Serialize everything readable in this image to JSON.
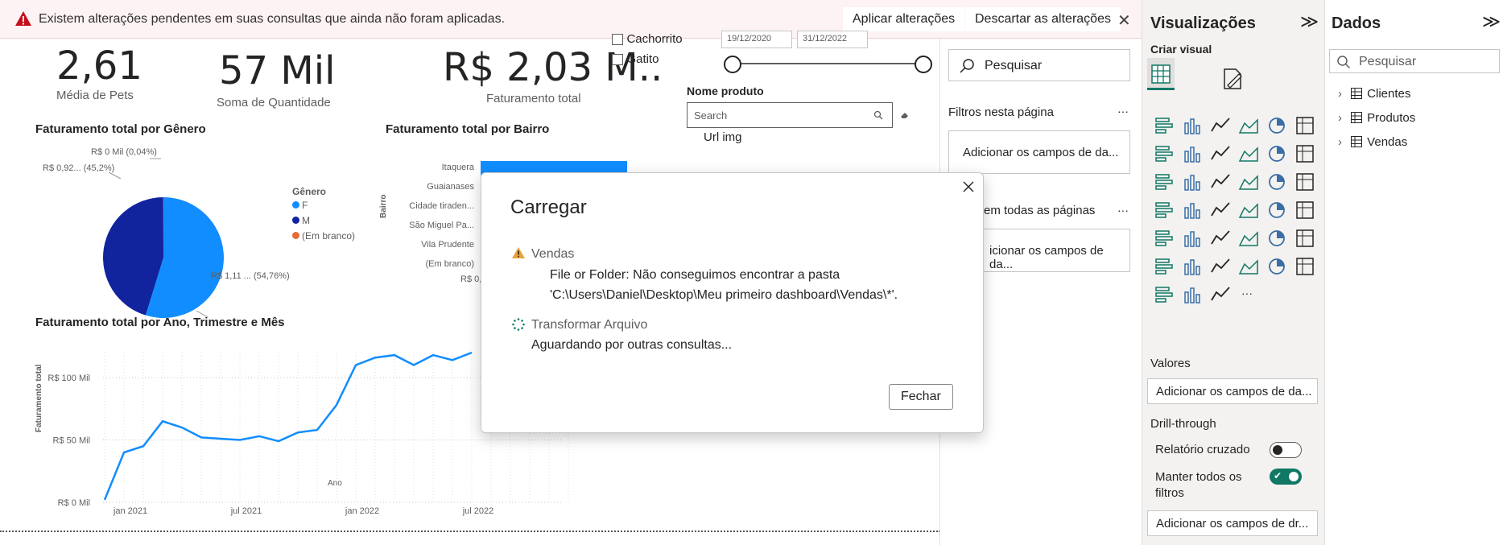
{
  "warning": {
    "message": "Existem alterações pendentes em suas consultas que ainda não foram aplicadas.",
    "apply_label": "Aplicar alterações",
    "discard_label": "Descartar as alterações",
    "close_glyph": "✕"
  },
  "cards": [
    {
      "value": "2,61",
      "label": "Média de Pets"
    },
    {
      "value": "57 Mil",
      "label": "Soma de Quantidade"
    },
    {
      "value": "R$ 2,03 M..",
      "label": "Faturamento total"
    }
  ],
  "slicer": {
    "options": [
      "Cachorrito",
      "Gatito"
    ],
    "date_start": "19/12/2020",
    "date_end": "31/12/2022",
    "product_title": "Nome produto",
    "search_placeholder": "Search",
    "url_label": "Url img"
  },
  "pie": {
    "title": "Faturamento total por Gênero",
    "legend_title": "Gênero",
    "legend": [
      {
        "name": "F",
        "color": "#118dff"
      },
      {
        "name": "M",
        "color": "#12239e"
      },
      {
        "name": "(Em branco)",
        "color": "#e66c37"
      }
    ],
    "labels": [
      "R$ 0 Mil (0,04%)",
      "R$ 0,92... (45,2%)",
      "R$ 1,11 ... (54,76%)"
    ]
  },
  "bar": {
    "title": "Faturamento total por Bairro",
    "ylabel": "Bairro",
    "categories": [
      "Itaquera",
      "Guaianases",
      "Cidade tiraden...",
      "São Miguel Pa...",
      "Vila Prudente",
      "(Em branco)"
    ],
    "first_tick": "R$ 0,"
  },
  "line": {
    "title": "Faturamento total por Ano, Trimestre e Mês",
    "ylabel": "Faturamento total",
    "xlabel": "Ano",
    "yticks": [
      "R$ 100 Mil",
      "R$ 50 Mil",
      "R$ 0 Mil"
    ],
    "xticks": [
      "jan 2021",
      "jul 2021",
      "jan 2022",
      "jul 2022"
    ]
  },
  "chart_data": [
    {
      "type": "pie",
      "title": "Faturamento total por Gênero",
      "categories": [
        "F",
        "M",
        "(Em branco)"
      ],
      "values": [
        54.76,
        45.2,
        0.04
      ],
      "legend_title": "Gênero",
      "legend_position": "right",
      "colors": [
        "#118dff",
        "#12239e",
        "#e66c37"
      ]
    },
    {
      "type": "bar",
      "title": "Faturamento total por Bairro",
      "ylabel": "Bairro",
      "categories": [
        "Itaquera",
        "Guaianases",
        "Cidade tiraden...",
        "São Miguel Pa...",
        "Vila Prudente",
        "(Em branco)"
      ],
      "values": [
        1.0,
        0.95,
        0.4,
        0.25,
        0.15,
        0.05
      ]
    },
    {
      "type": "line",
      "title": "Faturamento total por Ano, Trimestre e Mês",
      "xlabel": "Ano",
      "ylabel": "Faturamento total",
      "x": [
        "dez 2020",
        "jan 2021",
        "fev 2021",
        "mar 2021",
        "abr 2021",
        "mai 2021",
        "jun 2021",
        "jul 2021",
        "ago 2021",
        "set 2021",
        "out 2021",
        "nov 2021",
        "dez 2021",
        "jan 2022",
        "fev 2022",
        "mar 2022",
        "abr 2022",
        "mai 2022",
        "jun 2022",
        "jul 2022"
      ],
      "y": [
        2,
        40,
        45,
        65,
        60,
        52,
        51,
        50,
        53,
        49,
        56,
        58,
        78,
        110,
        116,
        118,
        110,
        118,
        114,
        120
      ],
      "ylim": [
        0,
        120
      ],
      "grid": true
    }
  ],
  "filters": {
    "search_placeholder": "Pesquisar",
    "page_filters": "Filtros nesta página",
    "add_fields": "Adicionar os campos de da...",
    "all_pages": "em todas as páginas",
    "add_fields2": "icionar os campos de da...",
    "more": "···"
  },
  "viz": {
    "title": "Visualizações",
    "expand": "≫",
    "build": "Criar visual",
    "values_title": "Valores",
    "values_add": "Adicionar os campos de da...",
    "drill_title": "Drill-through",
    "cross_report": "Relatório cruzado",
    "keep_filters": "Manter todos os",
    "keep_filters2": "filtros",
    "drill_add": "Adicionar os campos de dr..."
  },
  "data_pane": {
    "title": "Dados",
    "expand": "≫",
    "search_placeholder": "Pesquisar",
    "tables": [
      "Clientes",
      "Produtos",
      "Vendas"
    ]
  },
  "dialog": {
    "title": "Carregar",
    "error_name": "Vendas",
    "error_line1": "File or Folder: Não conseguimos encontrar a pasta",
    "error_line2": "'C:\\Users\\Daniel\\Desktop\\Meu primeiro dashboard\\Vendas\\*'.",
    "step_name": "Transformar Arquivo",
    "step_status": "Aguardando por outras consultas...",
    "close_label": "Fechar"
  },
  "colors": {
    "accent": "#118dff",
    "dark": "#12239e",
    "warn": "#c50f1f",
    "toggle_on": "#117865"
  }
}
